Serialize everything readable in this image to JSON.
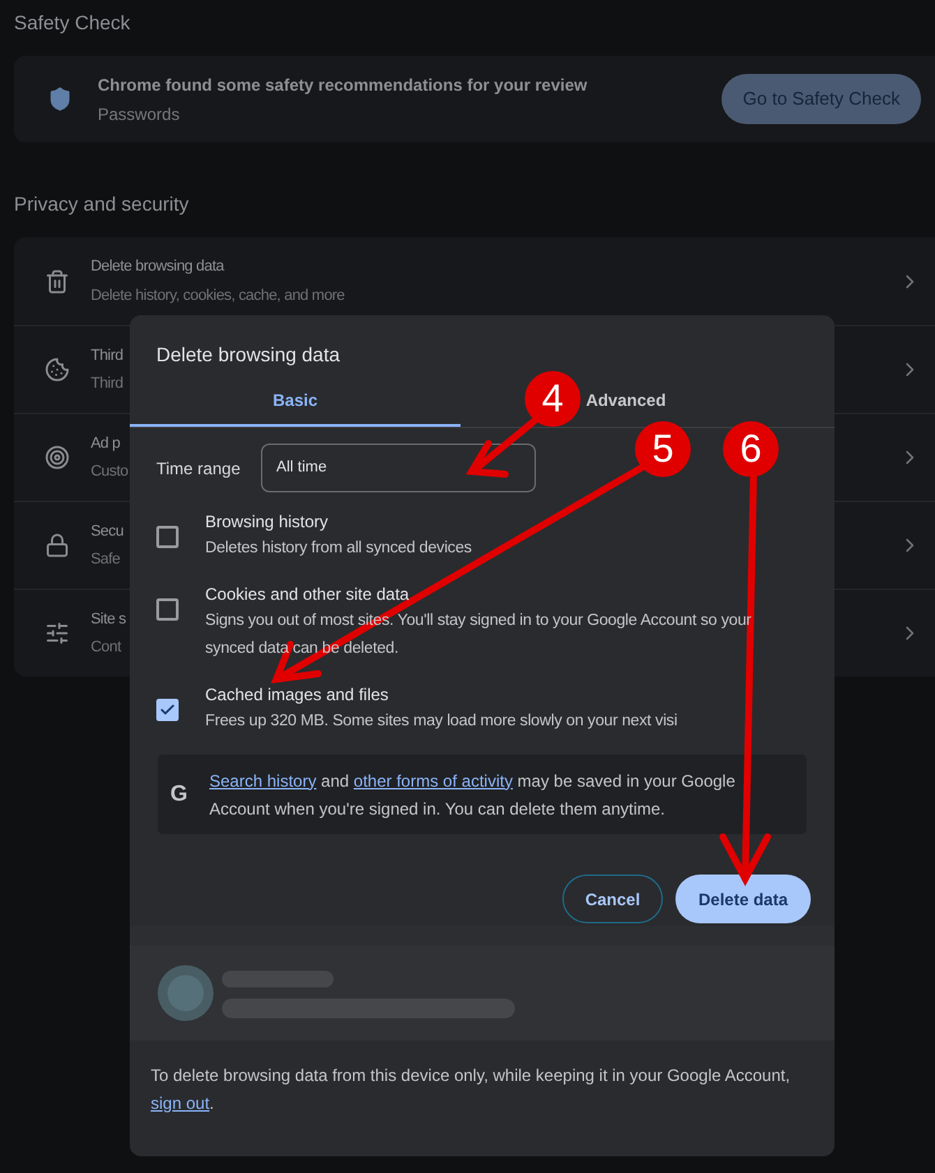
{
  "safety_check": {
    "heading": "Safety Check",
    "title": "Chrome found some safety recommendations for your review",
    "subtitle": "Passwords",
    "button": "Go to Safety Check"
  },
  "privacy": {
    "heading": "Privacy and security",
    "rows": [
      {
        "kind": "trash",
        "title": "Delete browsing data",
        "subtitle": "Delete history, cookies, cache, and more"
      },
      {
        "kind": "cookie",
        "title": "Third",
        "subtitle": "Third"
      },
      {
        "kind": "target",
        "title": "Ad p",
        "subtitle": "Custo"
      },
      {
        "kind": "lock",
        "title": "Secu",
        "subtitle": "Safe"
      },
      {
        "kind": "sliders",
        "title": "Site s",
        "subtitle": "Cont"
      }
    ]
  },
  "dialog": {
    "title": "Delete browsing data",
    "tabs": [
      {
        "label": "Basic",
        "selected": true
      },
      {
        "label": "Advanced",
        "selected": false
      }
    ],
    "time_range": {
      "label": "Time range",
      "value": "All time"
    },
    "options": [
      {
        "title": "Browsing history",
        "description": "Deletes history from all synced devices",
        "checked": false
      },
      {
        "title": "Cookies and other site data",
        "description": "Signs you out of most sites. You'll stay signed in to your Google Account so your synced data can be deleted.",
        "checked": false
      },
      {
        "title": "Cached images and files",
        "description": "Frees up 320 MB. Some sites may load more slowly on your next visi",
        "checked": true
      }
    ],
    "notice": {
      "icon": "G",
      "link_1": "Search history",
      "middle": " and ",
      "link_2": "other forms of activity",
      "rest": " may be saved in your Google Account when you're signed in. You can delete them anytime."
    },
    "buttons": {
      "cancel": "Cancel",
      "confirm": "Delete data"
    },
    "footer": {
      "text": "To delete browsing data from this device only, while keeping it in your Google Account, ",
      "link": "sign out",
      "end": "."
    }
  },
  "annotations": [
    {
      "label": "4"
    },
    {
      "label": "5"
    },
    {
      "label": "6"
    }
  ]
}
